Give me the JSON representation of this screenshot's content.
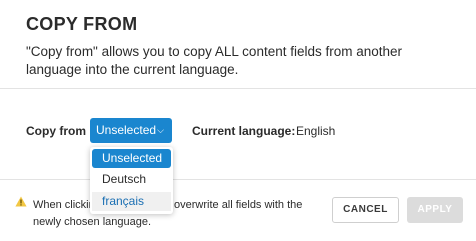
{
  "dialog": {
    "title": "COPY FROM",
    "description": "\"Copy from\" allows you to copy ALL content fields from another language into the current language."
  },
  "form": {
    "copy_from_label": "Copy from",
    "select_value": "Unselected",
    "chevron_icon": "chevron-down-icon",
    "current_language_label": "Current language:",
    "current_language_value": "English"
  },
  "dropdown": {
    "options": [
      "Unselected",
      "Deutsch",
      "français"
    ],
    "selected_index": 0,
    "hovered_index": 2
  },
  "footer": {
    "warning_icon": "warning-icon",
    "warning_text": "When clicking apply, this will overwrite all fields with the newly chosen language.",
    "cancel_label": "CANCEL",
    "apply_label": "APPLY"
  },
  "colors": {
    "accent": "#1a86cf",
    "warning": "#f2c744",
    "disabled_button": "#dcdcdc"
  }
}
